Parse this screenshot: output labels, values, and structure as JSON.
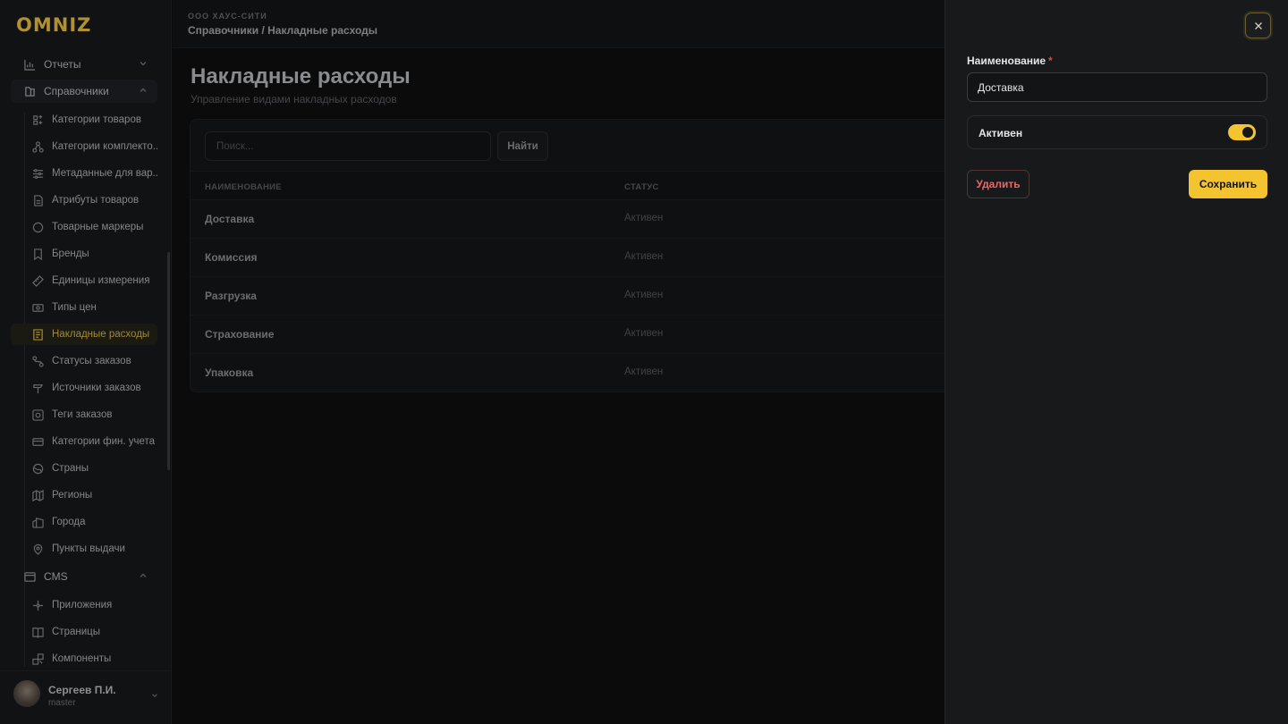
{
  "logo": "OMNIZ",
  "sidebar": {
    "sections": [
      {
        "label": "Отчеты",
        "icon": "chart-icon",
        "expanded": false
      },
      {
        "label": "Справочники",
        "icon": "book-icon",
        "expanded": true
      },
      {
        "label": "CMS",
        "icon": "window-icon",
        "expanded": true
      }
    ],
    "items": [
      {
        "label": "Категории товаров",
        "icon": "category-icon"
      },
      {
        "label": "Категории комплекто...",
        "icon": "hierarchy-icon"
      },
      {
        "label": "Метаданные для вар...",
        "icon": "sliders-icon"
      },
      {
        "label": "Атрибуты товаров",
        "icon": "file-icon"
      },
      {
        "label": "Товарные маркеры",
        "icon": "circle-icon"
      },
      {
        "label": "Бренды",
        "icon": "bookmark-icon"
      },
      {
        "label": "Единицы измерения",
        "icon": "ruler-icon"
      },
      {
        "label": "Типы цен",
        "icon": "money-icon"
      },
      {
        "label": "Накладные расходы",
        "icon": "invoice-icon",
        "active": true
      },
      {
        "label": "Статусы заказов",
        "icon": "route-icon"
      },
      {
        "label": "Источники заказов",
        "icon": "signpost-icon"
      },
      {
        "label": "Теги заказов",
        "icon": "tag-scan-icon"
      },
      {
        "label": "Категории фин. учета",
        "icon": "card-icon"
      },
      {
        "label": "Страны",
        "icon": "globe-icon"
      },
      {
        "label": "Регионы",
        "icon": "map-icon"
      },
      {
        "label": "Города",
        "icon": "building-icon"
      },
      {
        "label": "Пункты выдачи",
        "icon": "pin-icon"
      }
    ],
    "cms_items": [
      {
        "label": "Приложения",
        "icon": "apps-icon"
      },
      {
        "label": "Страницы",
        "icon": "book-open-icon"
      },
      {
        "label": "Компоненты",
        "icon": "components-icon"
      }
    ]
  },
  "user": {
    "name": "Сергеев П.И.",
    "role": "master"
  },
  "header": {
    "org": "ООО ХАУС-СИТИ",
    "breadcrumb": "Справочники / Накладные расходы"
  },
  "page": {
    "title": "Накладные расходы",
    "subtitle": "Управление видами накладных расходов"
  },
  "search": {
    "placeholder": "Поиск...",
    "button": "Найти"
  },
  "table": {
    "columns": [
      "НАИМЕНОВАНИЕ",
      "СТАТУС"
    ],
    "rows": [
      {
        "name": "Доставка",
        "status": "Активен"
      },
      {
        "name": "Комиссия",
        "status": "Активен"
      },
      {
        "name": "Разгрузка",
        "status": "Активен"
      },
      {
        "name": "Страхование",
        "status": "Активен"
      },
      {
        "name": "Упаковка",
        "status": "Активен"
      }
    ]
  },
  "drawer": {
    "name_label": "Наименование",
    "required_mark": "*",
    "name_value": "Доставка",
    "active_label": "Активен",
    "active": true,
    "delete_label": "Удалить",
    "save_label": "Сохранить"
  },
  "colors": {
    "accent": "#f4c430",
    "danger": "#e66a6a",
    "drawer_bg": "#18191b",
    "page_bg": "#0b0b0c"
  }
}
